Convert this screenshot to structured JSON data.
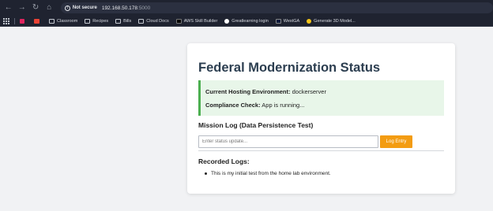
{
  "browser": {
    "security_label": "Not secure",
    "url_host": "192.168.50.178",
    "url_port": ":5000",
    "bookmarks": [
      {
        "label": "",
        "icon": "app-icon-p"
      },
      {
        "label": "",
        "icon": "gmail-icon"
      },
      {
        "label": "Classroom",
        "icon": "folder-icon"
      },
      {
        "label": "Recipes",
        "icon": "folder-icon"
      },
      {
        "label": "Bills",
        "icon": "folder-icon"
      },
      {
        "label": "Cloud Docs",
        "icon": "folder-icon"
      },
      {
        "label": "AWS Skill Builder",
        "icon": "aws-icon"
      },
      {
        "label": "Greatlearning login",
        "icon": "globe-icon"
      },
      {
        "label": "WestGA",
        "icon": "westga-icon"
      },
      {
        "label": "Generate 3D Model...",
        "icon": "model-icon"
      }
    ]
  },
  "page": {
    "title": "Federal Modernization Status",
    "status": {
      "env_label": "Current Hosting Environment:",
      "env_value": "dockerserver",
      "check_label": "Compliance Check:",
      "check_value": "App is running..."
    },
    "mission_heading": "Mission Log (Data Persistence Test)",
    "input_placeholder": "Enter status update...",
    "log_button": "Log Entry",
    "recorded_heading": "Recorded Logs:",
    "logs": [
      "This is my initial test from the home lab environment."
    ]
  },
  "colors": {
    "title": "#2c3e50",
    "status_bg": "#e8f6e9",
    "status_border": "#4caf50",
    "button": "#f39c12"
  }
}
